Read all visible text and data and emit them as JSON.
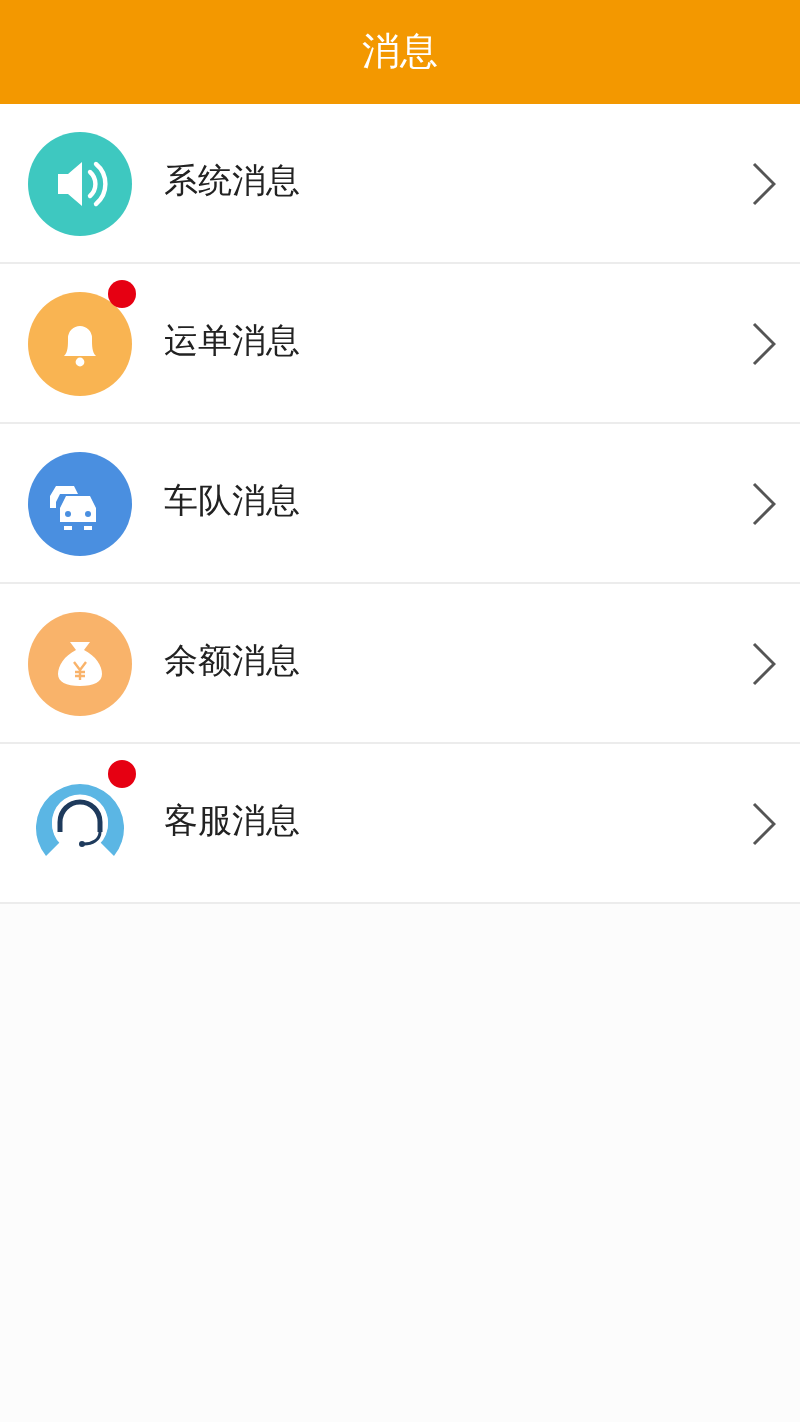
{
  "header": {
    "title": "消息"
  },
  "items": [
    {
      "kind": "system",
      "label": "系统消息",
      "unread": false
    },
    {
      "kind": "waybill",
      "label": "运单消息",
      "unread": true
    },
    {
      "kind": "fleet",
      "label": "车队消息",
      "unread": false
    },
    {
      "kind": "balance",
      "label": "余额消息",
      "unread": false
    },
    {
      "kind": "service",
      "label": "客服消息",
      "unread": true
    }
  ]
}
